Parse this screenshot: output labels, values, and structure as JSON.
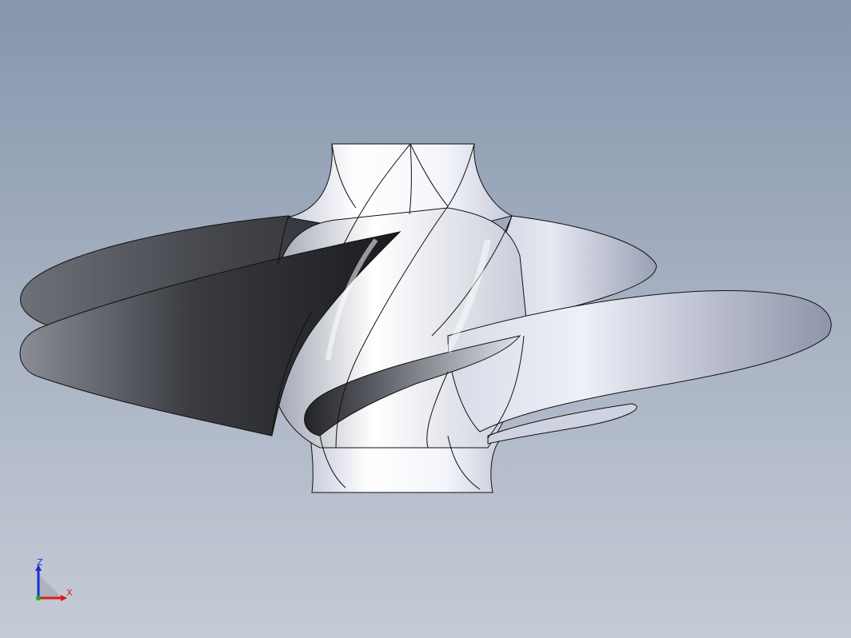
{
  "viewport": {
    "background_top": "#8796ad",
    "background_bottom": "#c5cbd6",
    "model": "spiral-impeller-icon"
  },
  "triad": {
    "z_label": "Z",
    "x_label": "X",
    "z_color": "#1a2fd6",
    "x_color": "#e01818",
    "y_color": "#1aa81a"
  }
}
